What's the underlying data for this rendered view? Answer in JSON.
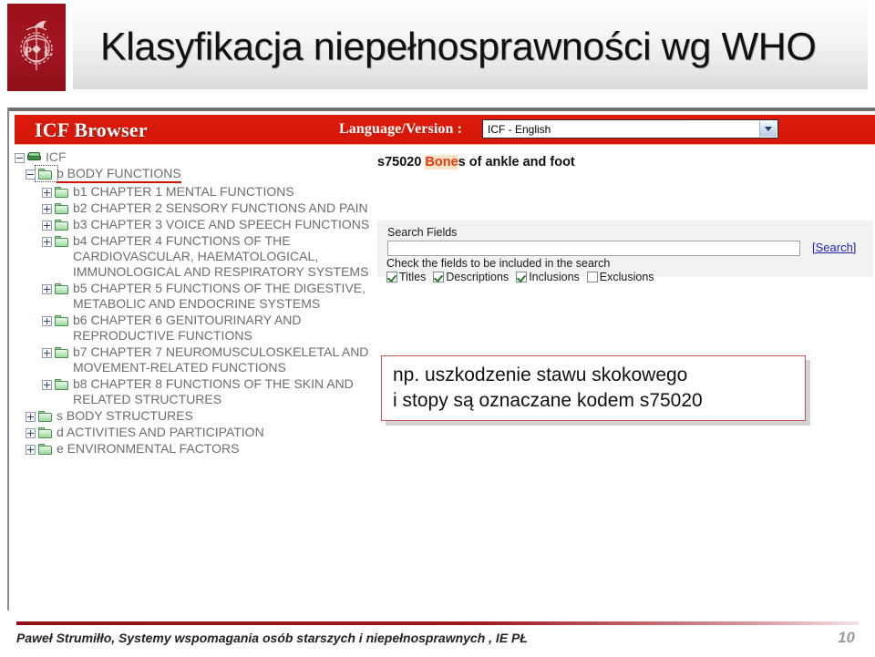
{
  "slide": {
    "title": "Klasyfikacja niepełnosprawności wg WHO",
    "logo_alt": "pl-university-crest"
  },
  "browser": {
    "app_title": "ICF Browser",
    "language": {
      "label": "Language/Version :",
      "selected": "ICF - English",
      "options": [
        "ICF - English"
      ]
    },
    "tree": [
      {
        "level": 0,
        "toggle": "minus",
        "icon": "book-icon",
        "label": "ICF",
        "selected": false
      },
      {
        "level": 1,
        "toggle": "minus",
        "icon": "folder-icon",
        "label": "b BODY FUNCTIONS",
        "selected": true
      },
      {
        "level": 2,
        "toggle": "plus",
        "icon": "folder-icon",
        "label": "b1 CHAPTER 1 MENTAL FUNCTIONS",
        "selected": false
      },
      {
        "level": 2,
        "toggle": "plus",
        "icon": "folder-icon",
        "label": "b2 CHAPTER 2 SENSORY FUNCTIONS AND PAIN",
        "selected": false
      },
      {
        "level": 2,
        "toggle": "plus",
        "icon": "folder-icon",
        "label": "b3 CHAPTER 3 VOICE AND SPEECH FUNCTIONS",
        "selected": false
      },
      {
        "level": 2,
        "toggle": "plus",
        "icon": "folder-icon",
        "label": "b4 CHAPTER 4 FUNCTIONS OF THE CARDIOVASCULAR, HAEMATOLOGICAL, IMMUNOLOGICAL AND RESPIRATORY SYSTEMS",
        "selected": false
      },
      {
        "level": 2,
        "toggle": "plus",
        "icon": "folder-icon",
        "label": "b5 CHAPTER 5 FUNCTIONS OF THE DIGESTIVE, METABOLIC AND ENDOCRINE SYSTEMS",
        "selected": false
      },
      {
        "level": 2,
        "toggle": "plus",
        "icon": "folder-icon",
        "label": "b6 CHAPTER 6 GENITOURINARY AND REPRODUCTIVE FUNCTIONS",
        "selected": false
      },
      {
        "level": 2,
        "toggle": "plus",
        "icon": "folder-icon",
        "label": "b7 CHAPTER 7 NEUROMUSCULOSKELETAL AND MOVEMENT-RELATED FUNCTIONS",
        "selected": false
      },
      {
        "level": 2,
        "toggle": "plus",
        "icon": "folder-icon",
        "label": "b8 CHAPTER 8 FUNCTIONS OF THE SKIN AND RELATED STRUCTURES",
        "selected": false
      },
      {
        "level": 1,
        "toggle": "plus",
        "icon": "folder-icon",
        "label": "s BODY STRUCTURES",
        "selected": false
      },
      {
        "level": 1,
        "toggle": "plus",
        "icon": "folder-icon",
        "label": "d ACTIVITIES AND PARTICIPATION",
        "selected": false
      },
      {
        "level": 1,
        "toggle": "plus",
        "icon": "folder-icon",
        "label": "e ENVIRONMENTAL FACTORS",
        "selected": false
      }
    ],
    "result": {
      "code": "s75020 ",
      "highlight": "Bone",
      "rest": "s of ankle and foot"
    },
    "search": {
      "fields_label": "Search Fields",
      "input_value": "",
      "input_placeholder": "",
      "search_link": "[Search]",
      "hint": "Check the fields to be included in the search",
      "checkboxes": [
        {
          "label": "Titles",
          "checked": true
        },
        {
          "label": "Descriptions",
          "checked": true
        },
        {
          "label": "Inclusions",
          "checked": true
        },
        {
          "label": "Exclusions",
          "checked": false
        }
      ]
    }
  },
  "callout": {
    "text": "np. uszkodzenie stawu skokowego\ni stopy są oznaczane kodem s75020"
  },
  "footer": {
    "text": "Paweł Strumiłło, Systemy wspomagania osób  starszych i niepełnosprawnych , IE PŁ",
    "page": "10"
  },
  "colors": {
    "brand_red": "#d9190a",
    "crest_red": "#9e1220",
    "accent_underline": "#cc1111",
    "link_blue": "#2222bb",
    "highlight_bg": "#fbe3c9",
    "highlight_fg": "#e23b0b"
  }
}
